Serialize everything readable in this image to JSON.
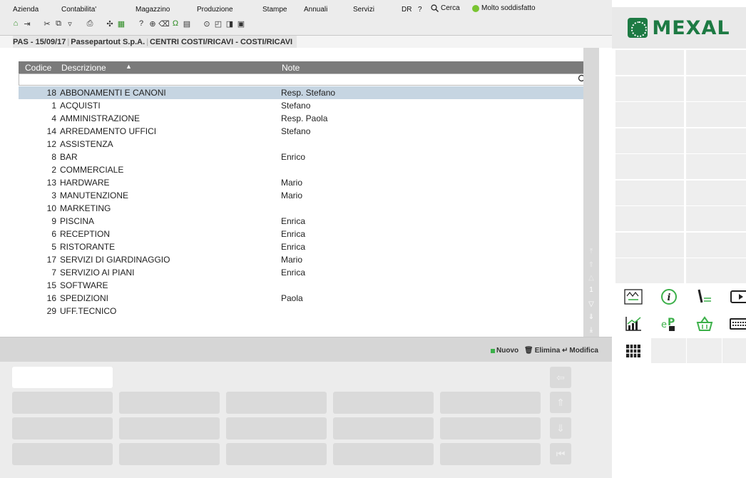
{
  "menu": {
    "items": [
      "Azienda",
      "Contabilita'",
      "Magazzino",
      "Produzione",
      "Stampe",
      "Annuali",
      "Servizi"
    ],
    "dr": "DR",
    "help": "?",
    "search_label": "Cerca",
    "satisfaction_label": "Molto soddisfatto"
  },
  "breadcrumb": {
    "session": "PAS - 15/09/17",
    "company": "Passepartout S.p.A.",
    "screen": "CENTRI COSTI/RICAVI - COSTI/RICAVI"
  },
  "grid": {
    "columns": {
      "code": "Codice",
      "description": "Descrizione",
      "note": "Note"
    },
    "sort_indicator": "▲",
    "filter_value": "",
    "rows": [
      {
        "code": "18",
        "description": "ABBONAMENTI E CANONI",
        "note": "Resp. Stefano",
        "selected": true
      },
      {
        "code": "1",
        "description": "ACQUISTI",
        "note": "Stefano"
      },
      {
        "code": "4",
        "description": "AMMINISTRAZIONE",
        "note": "Resp. Paola"
      },
      {
        "code": "14",
        "description": "ARREDAMENTO UFFICI",
        "note": "Stefano"
      },
      {
        "code": "12",
        "description": "ASSISTENZA",
        "note": ""
      },
      {
        "code": "8",
        "description": "BAR",
        "note": "Enrico"
      },
      {
        "code": "2",
        "description": "COMMERCIALE",
        "note": ""
      },
      {
        "code": "13",
        "description": "HARDWARE",
        "note": "Mario"
      },
      {
        "code": "3",
        "description": "MANUTENZIONE",
        "note": "Mario"
      },
      {
        "code": "10",
        "description": "MARKETING",
        "note": ""
      },
      {
        "code": "9",
        "description": "PISCINA",
        "note": "Enrica"
      },
      {
        "code": "6",
        "description": "RECEPTION",
        "note": "Enrica"
      },
      {
        "code": "5",
        "description": "RISTORANTE",
        "note": "Enrica"
      },
      {
        "code": "17",
        "description": "SERVIZI DI GIARDINAGGIO",
        "note": "Mario"
      },
      {
        "code": "7",
        "description": "SERVIZIO AI PIANI",
        "note": "Enrica"
      },
      {
        "code": "15",
        "description": "SOFTWARE",
        "note": ""
      },
      {
        "code": "16",
        "description": "SPEDIZIONI",
        "note": "Paola"
      },
      {
        "code": "29",
        "description": "UFF.TECNICO",
        "note": ""
      }
    ],
    "page_number": "1"
  },
  "actions": {
    "new": "Nuovo",
    "delete": "Elimina",
    "edit": "Modifica"
  },
  "logo": {
    "text": "MEXAL"
  },
  "colors": {
    "selection": "#c6d5e2",
    "header": "#7b7b7b",
    "brand_green": "#1d7a43",
    "accent_green": "#3cb04a"
  }
}
